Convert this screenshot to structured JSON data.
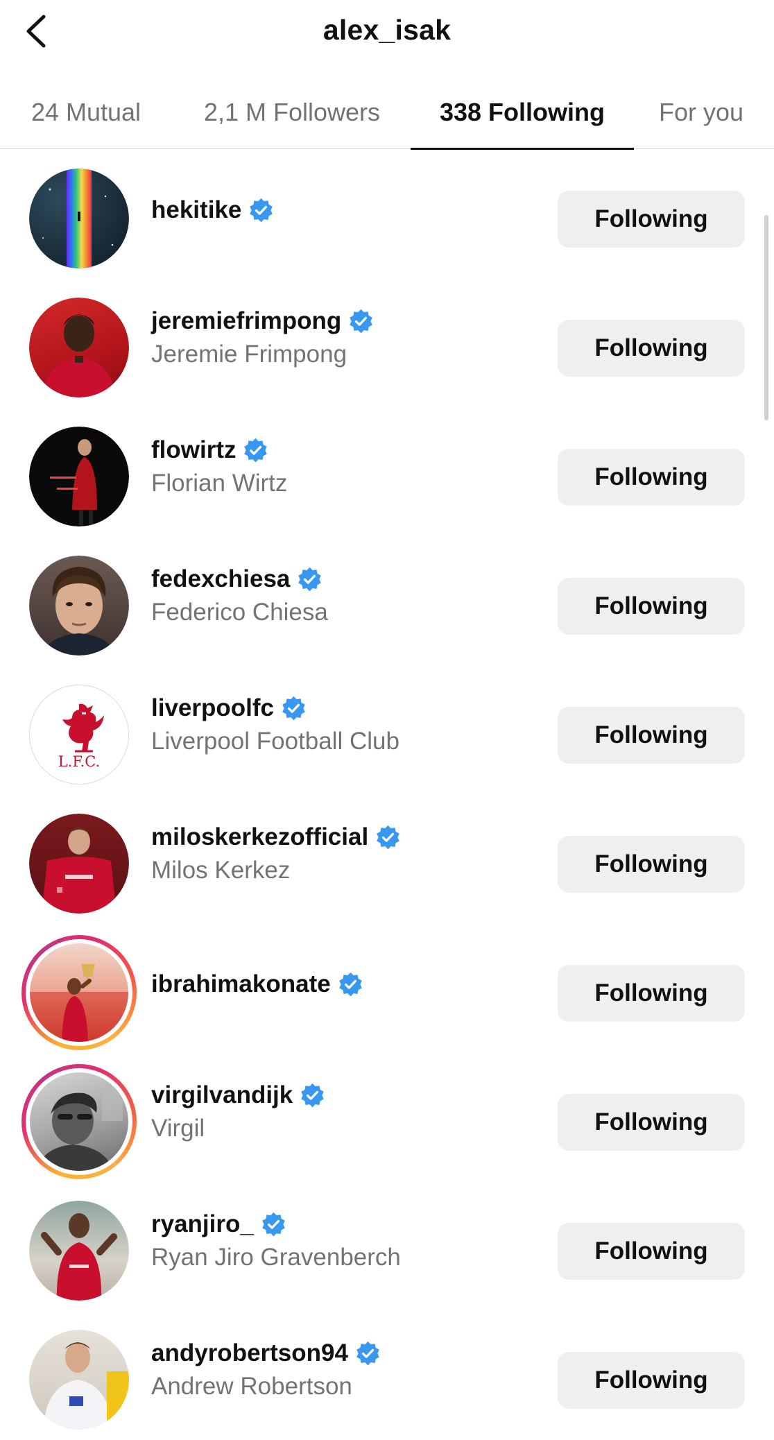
{
  "header": {
    "title": "alex_isak",
    "back_icon": "chevron-left-icon"
  },
  "tabs": [
    {
      "label": "24 Mutual",
      "active": false
    },
    {
      "label": "2,1 M Followers",
      "active": false
    },
    {
      "label": "338 Following",
      "active": true
    },
    {
      "label": "For you",
      "active": false
    }
  ],
  "colors": {
    "verified_badge": "#3897f0",
    "button_bg": "#efefef",
    "secondary_text": "#737373",
    "story_ring": "#e1306c"
  },
  "accounts": [
    {
      "username": "hekitike",
      "full_name": "",
      "verified": true,
      "button": "Following",
      "story": false,
      "avatar": "rainbow-night-sky"
    },
    {
      "username": "jeremiefrimpong",
      "full_name": "Jeremie Frimpong",
      "verified": true,
      "button": "Following",
      "story": false,
      "avatar": "player-red-kit"
    },
    {
      "username": "flowirtz",
      "full_name": "Florian Wirtz",
      "verified": true,
      "button": "Following",
      "story": false,
      "avatar": "player-dark-background"
    },
    {
      "username": "fedexchiesa",
      "full_name": "Federico Chiesa",
      "verified": true,
      "button": "Following",
      "story": false,
      "avatar": "portrait"
    },
    {
      "username": "liverpoolfc",
      "full_name": "Liverpool Football Club",
      "verified": true,
      "button": "Following",
      "story": false,
      "avatar": "lfc-crest",
      "logo_text": "L.F.C."
    },
    {
      "username": "miloskerkezofficial",
      "full_name": "Milos Kerkez",
      "verified": true,
      "button": "Following",
      "story": false,
      "avatar": "player-holding-shirt"
    },
    {
      "username": "ibrahimakonate",
      "full_name": "",
      "verified": true,
      "button": "Following",
      "story": true,
      "avatar": "trophy-celebration"
    },
    {
      "username": "virgilvandijk",
      "full_name": "Virgil",
      "verified": true,
      "button": "Following",
      "story": true,
      "avatar": "black-white-portrait"
    },
    {
      "username": "ryanjiro_",
      "full_name": "Ryan Jiro Gravenberch",
      "verified": true,
      "button": "Following",
      "story": false,
      "avatar": "player-celebrating"
    },
    {
      "username": "andyrobertson94",
      "full_name": "Andrew Robertson",
      "verified": true,
      "button": "Following",
      "story": false,
      "avatar": "player-scotland-kit"
    }
  ]
}
